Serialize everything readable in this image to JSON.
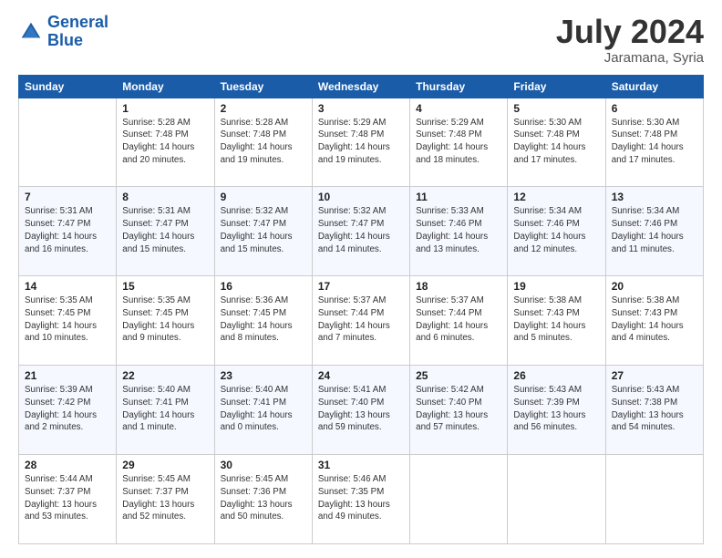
{
  "header": {
    "logo_line1": "General",
    "logo_line2": "Blue",
    "month": "July 2024",
    "location": "Jaramana, Syria"
  },
  "weekdays": [
    "Sunday",
    "Monday",
    "Tuesday",
    "Wednesday",
    "Thursday",
    "Friday",
    "Saturday"
  ],
  "weeks": [
    [
      {
        "day": "",
        "info": ""
      },
      {
        "day": "1",
        "info": "Sunrise: 5:28 AM\nSunset: 7:48 PM\nDaylight: 14 hours\nand 20 minutes."
      },
      {
        "day": "2",
        "info": "Sunrise: 5:28 AM\nSunset: 7:48 PM\nDaylight: 14 hours\nand 19 minutes."
      },
      {
        "day": "3",
        "info": "Sunrise: 5:29 AM\nSunset: 7:48 PM\nDaylight: 14 hours\nand 19 minutes."
      },
      {
        "day": "4",
        "info": "Sunrise: 5:29 AM\nSunset: 7:48 PM\nDaylight: 14 hours\nand 18 minutes."
      },
      {
        "day": "5",
        "info": "Sunrise: 5:30 AM\nSunset: 7:48 PM\nDaylight: 14 hours\nand 17 minutes."
      },
      {
        "day": "6",
        "info": "Sunrise: 5:30 AM\nSunset: 7:48 PM\nDaylight: 14 hours\nand 17 minutes."
      }
    ],
    [
      {
        "day": "7",
        "info": "Sunrise: 5:31 AM\nSunset: 7:47 PM\nDaylight: 14 hours\nand 16 minutes."
      },
      {
        "day": "8",
        "info": "Sunrise: 5:31 AM\nSunset: 7:47 PM\nDaylight: 14 hours\nand 15 minutes."
      },
      {
        "day": "9",
        "info": "Sunrise: 5:32 AM\nSunset: 7:47 PM\nDaylight: 14 hours\nand 15 minutes."
      },
      {
        "day": "10",
        "info": "Sunrise: 5:32 AM\nSunset: 7:47 PM\nDaylight: 14 hours\nand 14 minutes."
      },
      {
        "day": "11",
        "info": "Sunrise: 5:33 AM\nSunset: 7:46 PM\nDaylight: 14 hours\nand 13 minutes."
      },
      {
        "day": "12",
        "info": "Sunrise: 5:34 AM\nSunset: 7:46 PM\nDaylight: 14 hours\nand 12 minutes."
      },
      {
        "day": "13",
        "info": "Sunrise: 5:34 AM\nSunset: 7:46 PM\nDaylight: 14 hours\nand 11 minutes."
      }
    ],
    [
      {
        "day": "14",
        "info": "Sunrise: 5:35 AM\nSunset: 7:45 PM\nDaylight: 14 hours\nand 10 minutes."
      },
      {
        "day": "15",
        "info": "Sunrise: 5:35 AM\nSunset: 7:45 PM\nDaylight: 14 hours\nand 9 minutes."
      },
      {
        "day": "16",
        "info": "Sunrise: 5:36 AM\nSunset: 7:45 PM\nDaylight: 14 hours\nand 8 minutes."
      },
      {
        "day": "17",
        "info": "Sunrise: 5:37 AM\nSunset: 7:44 PM\nDaylight: 14 hours\nand 7 minutes."
      },
      {
        "day": "18",
        "info": "Sunrise: 5:37 AM\nSunset: 7:44 PM\nDaylight: 14 hours\nand 6 minutes."
      },
      {
        "day": "19",
        "info": "Sunrise: 5:38 AM\nSunset: 7:43 PM\nDaylight: 14 hours\nand 5 minutes."
      },
      {
        "day": "20",
        "info": "Sunrise: 5:38 AM\nSunset: 7:43 PM\nDaylight: 14 hours\nand 4 minutes."
      }
    ],
    [
      {
        "day": "21",
        "info": "Sunrise: 5:39 AM\nSunset: 7:42 PM\nDaylight: 14 hours\nand 2 minutes."
      },
      {
        "day": "22",
        "info": "Sunrise: 5:40 AM\nSunset: 7:41 PM\nDaylight: 14 hours\nand 1 minute."
      },
      {
        "day": "23",
        "info": "Sunrise: 5:40 AM\nSunset: 7:41 PM\nDaylight: 14 hours\nand 0 minutes."
      },
      {
        "day": "24",
        "info": "Sunrise: 5:41 AM\nSunset: 7:40 PM\nDaylight: 13 hours\nand 59 minutes."
      },
      {
        "day": "25",
        "info": "Sunrise: 5:42 AM\nSunset: 7:40 PM\nDaylight: 13 hours\nand 57 minutes."
      },
      {
        "day": "26",
        "info": "Sunrise: 5:43 AM\nSunset: 7:39 PM\nDaylight: 13 hours\nand 56 minutes."
      },
      {
        "day": "27",
        "info": "Sunrise: 5:43 AM\nSunset: 7:38 PM\nDaylight: 13 hours\nand 54 minutes."
      }
    ],
    [
      {
        "day": "28",
        "info": "Sunrise: 5:44 AM\nSunset: 7:37 PM\nDaylight: 13 hours\nand 53 minutes."
      },
      {
        "day": "29",
        "info": "Sunrise: 5:45 AM\nSunset: 7:37 PM\nDaylight: 13 hours\nand 52 minutes."
      },
      {
        "day": "30",
        "info": "Sunrise: 5:45 AM\nSunset: 7:36 PM\nDaylight: 13 hours\nand 50 minutes."
      },
      {
        "day": "31",
        "info": "Sunrise: 5:46 AM\nSunset: 7:35 PM\nDaylight: 13 hours\nand 49 minutes."
      },
      {
        "day": "",
        "info": ""
      },
      {
        "day": "",
        "info": ""
      },
      {
        "day": "",
        "info": ""
      }
    ]
  ]
}
